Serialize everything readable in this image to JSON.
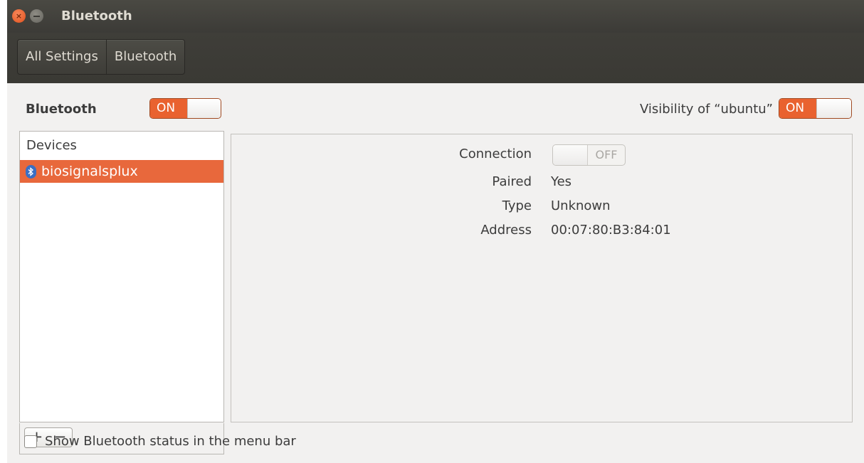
{
  "window": {
    "title": "Bluetooth"
  },
  "toolbar": {
    "crumbs": [
      "All Settings",
      "Bluetooth"
    ]
  },
  "bluetooth": {
    "label": "Bluetooth",
    "state": "ON"
  },
  "visibility": {
    "label": "Visibility of “ubuntu”",
    "state": "ON"
  },
  "devices": {
    "header": "Devices",
    "items": [
      {
        "name": "biosignalsplux",
        "selected": true
      }
    ],
    "add_label": "+",
    "remove_label": "−"
  },
  "details": {
    "connection": {
      "label": "Connection",
      "state": "OFF"
    },
    "paired": {
      "label": "Paired",
      "value": "Yes"
    },
    "type": {
      "label": "Type",
      "value": "Unknown"
    },
    "address": {
      "label": "Address",
      "value": "00:07:80:B3:84:01"
    }
  },
  "status_option": {
    "label": "Show Bluetooth status in the menu bar",
    "checked": false
  },
  "colors": {
    "accent": "#e9622f",
    "titlebar": "#3c3b37"
  }
}
